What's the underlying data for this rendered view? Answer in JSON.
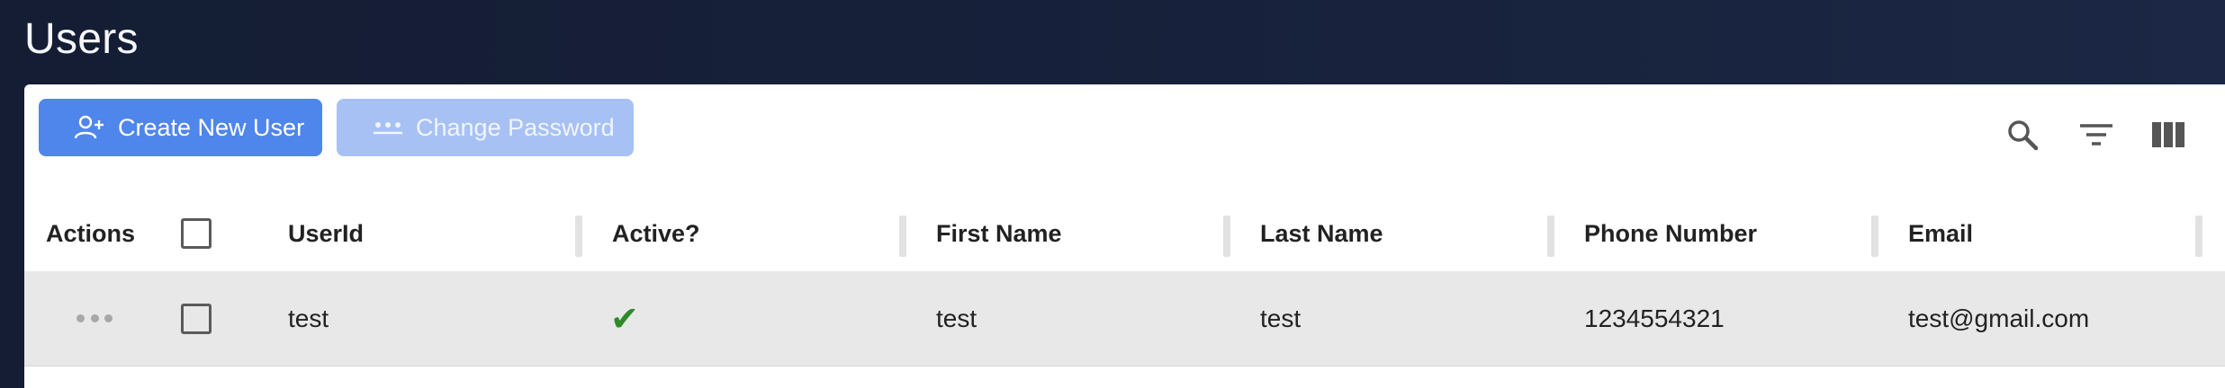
{
  "page": {
    "title": "Users"
  },
  "toolbar": {
    "create_label": "Create New User",
    "password_label": "Change Password"
  },
  "table": {
    "columns": [
      "Actions",
      "UserId",
      "Active?",
      "First Name",
      "Last Name",
      "Phone Number",
      "Email"
    ],
    "rows": [
      {
        "userid": "test",
        "active": "✔",
        "first_name": "test",
        "last_name": "test",
        "phone": "1234554321",
        "email": "test@gmail.com"
      }
    ]
  },
  "colors": {
    "primary": "#4f86ec",
    "primary_disabled": "#a7c1f4",
    "active_check": "#2f8a2a",
    "background": "#17213b"
  },
  "icons": [
    "add-user-icon",
    "password-dots-icon",
    "search-icon",
    "filter-icon",
    "columns-icon",
    "more-dots-icon",
    "checkmark-icon"
  ]
}
